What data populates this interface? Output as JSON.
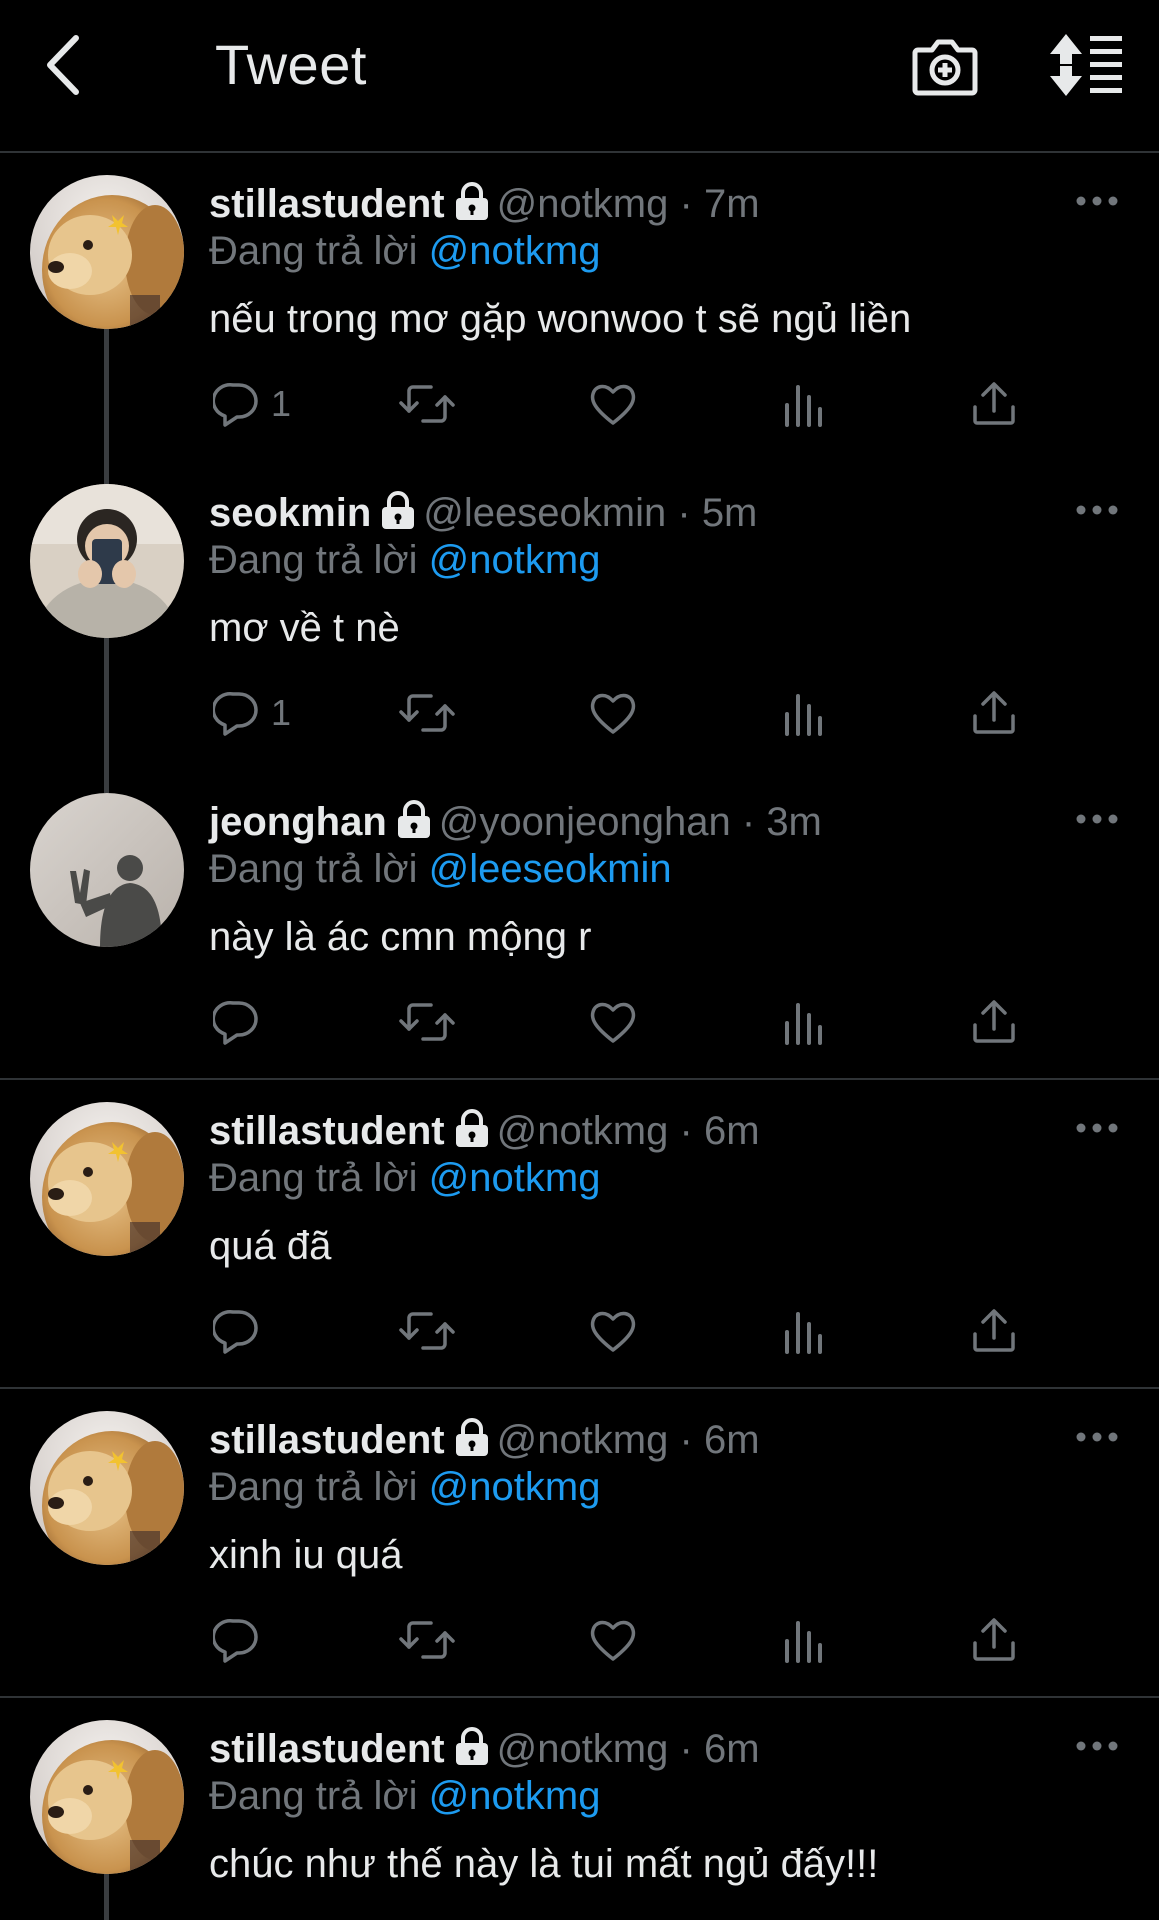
{
  "header": {
    "title": "Tweet",
    "back_icon": "chevron-left-icon",
    "camera_icon": "camera-add-icon",
    "sort_icon": "sort-icon"
  },
  "labels": {
    "replying_to": "Đang trả lời",
    "separator": "·"
  },
  "colors": {
    "background": "#000000",
    "text": "#e7e9ea",
    "muted": "#71767b",
    "link": "#1d9bf0",
    "divider": "#2f3336"
  },
  "tweets": [
    {
      "name": "stillastudent",
      "handle": "@notkmg",
      "time": "7m",
      "reply_to": "@notkmg",
      "text": "nếu trong mơ gặp wonwoo t sẽ ngủ liền",
      "replies": "1",
      "avatar": "golden-retriever-photo"
    },
    {
      "name": "seokmin",
      "handle": "@leeseokmin",
      "time": "5m",
      "reply_to": "@notkmg",
      "text": "mơ về t nè",
      "replies": "1",
      "avatar": "mirror-selfie-photo"
    },
    {
      "name": "jeonghan",
      "handle": "@yoonjeonghan",
      "time": "3m",
      "reply_to": "@leeseokmin",
      "text": "này là ác cmn mộng r",
      "replies": "",
      "avatar": "shadow-photo"
    },
    {
      "name": "stillastudent",
      "handle": "@notkmg",
      "time": "6m",
      "reply_to": "@notkmg",
      "text": "quá đã",
      "replies": "",
      "avatar": "golden-retriever-photo"
    },
    {
      "name": "stillastudent",
      "handle": "@notkmg",
      "time": "6m",
      "reply_to": "@notkmg",
      "text": "xinh iu quá",
      "replies": "",
      "avatar": "golden-retriever-photo"
    },
    {
      "name": "stillastudent",
      "handle": "@notkmg",
      "time": "6m",
      "reply_to": "@notkmg",
      "text": "chúc như thế này là tui mất ngủ đấy!!!",
      "replies": "",
      "avatar": "golden-retriever-photo"
    }
  ]
}
